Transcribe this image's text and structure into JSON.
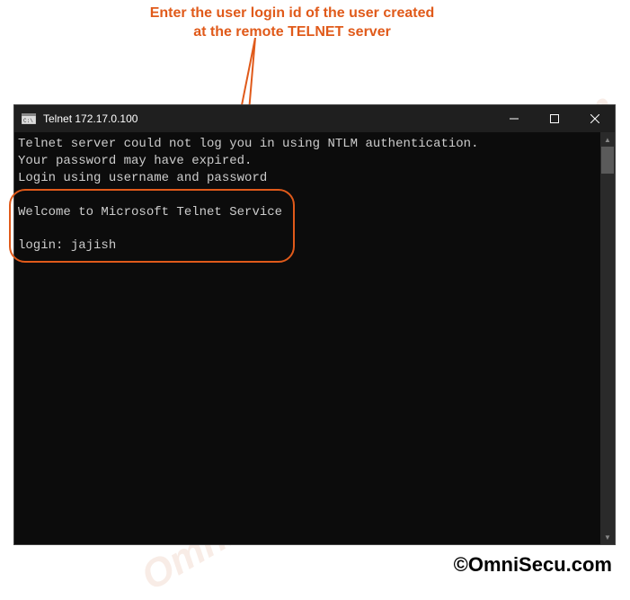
{
  "annotation": {
    "line1": "Enter the user login id of the user created",
    "line2": "at the remote TELNET server"
  },
  "titlebar": {
    "title": "Telnet 172.17.0.100"
  },
  "terminal": {
    "line1": "Telnet server could not log you in using NTLM authentication.",
    "line2": "Your password may have expired.",
    "line3": "Login using username and password",
    "line4": "",
    "line5": "Welcome to Microsoft Telnet Service",
    "line6": "",
    "line7_prompt": "login: ",
    "line7_input": "jajish"
  },
  "watermark": "OmniSecu.com",
  "copyright": "©OmniSecu.com"
}
